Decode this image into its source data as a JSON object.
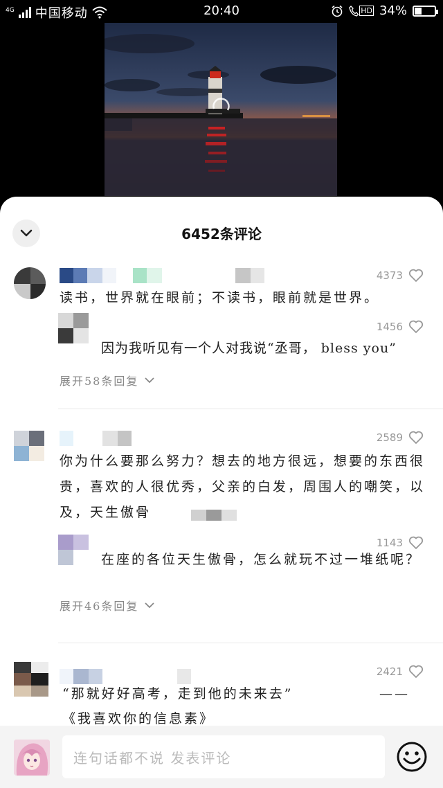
{
  "status_bar": {
    "network": "4G",
    "carrier": "中国移动",
    "time": "20:40",
    "hd": "HD",
    "battery": "34%",
    "battery_level": 0.34
  },
  "sheet": {
    "title": "6452条评论"
  },
  "comments": [
    {
      "likes": "4373",
      "text": "读书，世界就在眼前；不读书，眼前就是世界。",
      "reply": {
        "likes": "1456",
        "text": "因为我听见有一个人对我说“丞哥， bless you”"
      },
      "expand": "展开58条回复"
    },
    {
      "likes": "2589",
      "text": "你为什么要那么努力？想去的地方很远，想要的东西很贵，喜欢的人很优秀，父亲的白发，周围人的嘲笑，以及，天生傲骨",
      "reply": {
        "likes": "1143",
        "text": "在座的各位天生傲骨，怎么就玩不过一堆纸呢？"
      },
      "expand": "展开46条回复"
    },
    {
      "likes": "2421",
      "text_line1": "“那就好好高考，走到他的未来去”",
      "text_dash": "——",
      "text_line2": "《我喜欢你的信息素》"
    }
  ],
  "input": {
    "placeholder": "连句话都不说 发表评论"
  },
  "icons": {
    "collapse": "chevron-down-icon",
    "like": "heart-icon",
    "expand": "chevron-down-icon",
    "emoji": "smiley-icon"
  }
}
